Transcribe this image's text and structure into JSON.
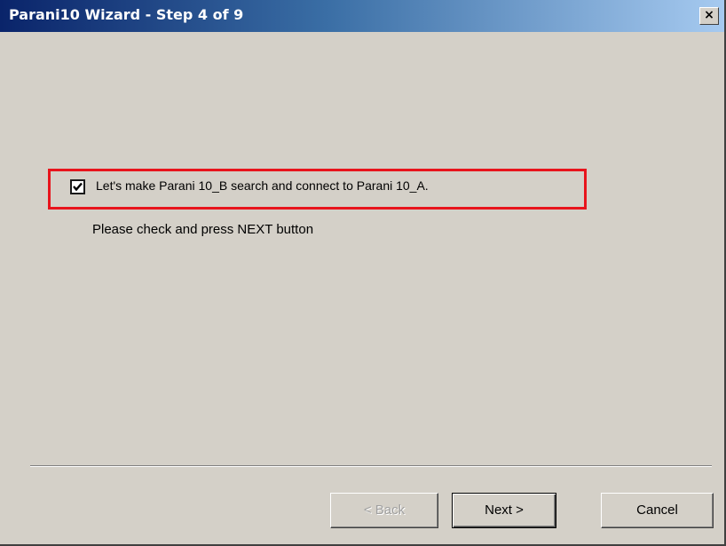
{
  "window": {
    "title": "Parani10 Wizard - Step 4 of 9",
    "close_label": "×"
  },
  "content": {
    "checkbox_label": "Let's make Parani 10_B search and connect to Parani 10_A.",
    "checkbox_checked": true,
    "instruction": "Please check and press NEXT button"
  },
  "buttons": {
    "back_label": "< Back",
    "back_enabled": false,
    "next_label": "Next >",
    "cancel_label": "Cancel"
  },
  "colors": {
    "highlight": "#e8141c",
    "dialog_background": "#d4d0c8",
    "titlebar_start": "#0a246a",
    "titlebar_end": "#a6caf0"
  }
}
